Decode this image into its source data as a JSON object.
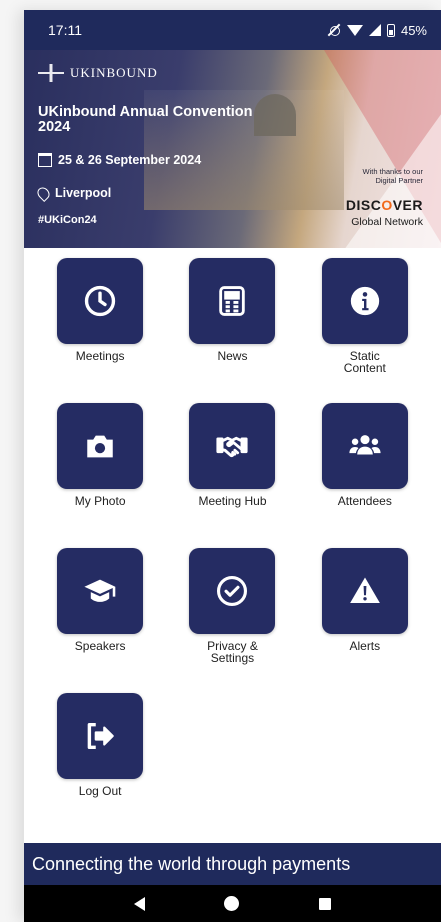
{
  "status_bar": {
    "time": "17:11",
    "battery": "45%"
  },
  "banner": {
    "logo_text": "UKINBOUND",
    "title": "UKinbound Annual Convention 2024",
    "dates": "25 & 26 September 2024",
    "location": "Liverpool",
    "hashtag": "#UKiCon24",
    "thanks": "With thanks to our Digital Partner",
    "partner_pre": "DISC",
    "partner_o": "O",
    "partner_post": "VER",
    "partner_sub": "Global Network"
  },
  "tiles": [
    {
      "label": "Meetings",
      "icon": "clock-icon"
    },
    {
      "label": "News",
      "icon": "newspaper-icon"
    },
    {
      "label": "Static\nContent",
      "icon": "info-icon"
    },
    {
      "label": "My Photo",
      "icon": "camera-icon"
    },
    {
      "label": "Meeting Hub",
      "icon": "handshake-icon"
    },
    {
      "label": "Attendees",
      "icon": "users-icon"
    },
    {
      "label": "Speakers",
      "icon": "graduation-cap-icon"
    },
    {
      "label": "Privacy &\nSettings",
      "icon": "check-circle-icon"
    },
    {
      "label": "Alerts",
      "icon": "warning-icon"
    },
    {
      "label": "Log Out",
      "icon": "logout-icon"
    }
  ],
  "footer": {
    "tagline": "Connecting the world through payments"
  },
  "colors": {
    "primary": "#252c63",
    "status_bar": "#1f2a5c",
    "accent_orange": "#f26a1c"
  }
}
